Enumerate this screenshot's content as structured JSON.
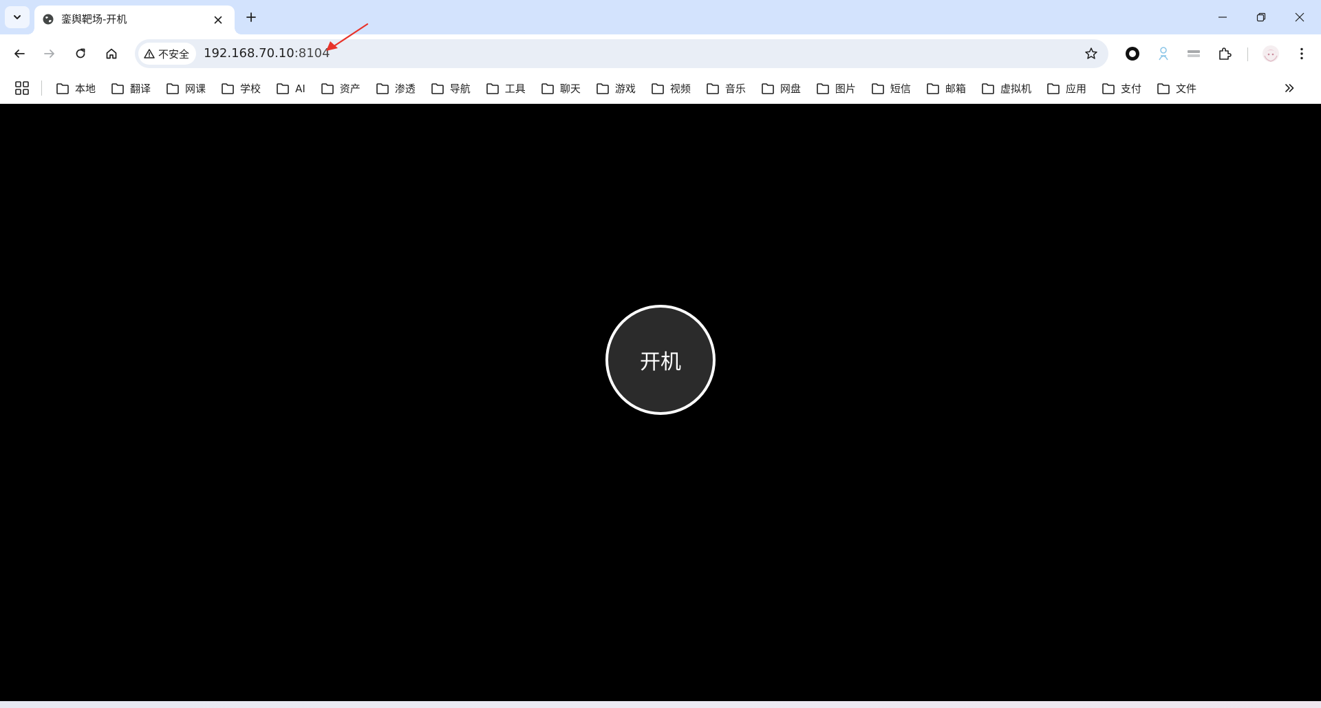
{
  "tab": {
    "title": "銮舆靶场-开机",
    "favicon": "globe-icon"
  },
  "toolbar": {
    "security_label": "不安全",
    "url_host": "192.168.70.10",
    "url_port": ":8104"
  },
  "bookmarks": [
    {
      "label": "本地"
    },
    {
      "label": "翻译"
    },
    {
      "label": "网课"
    },
    {
      "label": "学校"
    },
    {
      "label": "AI"
    },
    {
      "label": "资产"
    },
    {
      "label": "渗透"
    },
    {
      "label": "导航"
    },
    {
      "label": "工具"
    },
    {
      "label": "聊天"
    },
    {
      "label": "游戏"
    },
    {
      "label": "视频"
    },
    {
      "label": "音乐"
    },
    {
      "label": "网盘"
    },
    {
      "label": "图片"
    },
    {
      "label": "短信"
    },
    {
      "label": "邮箱"
    },
    {
      "label": "虚拟机"
    },
    {
      "label": "应用"
    },
    {
      "label": "支付"
    },
    {
      "label": "文件"
    }
  ],
  "page": {
    "power_button_label": "开机"
  },
  "colors": {
    "tabstrip_bg": "#d3e3fd",
    "omnibox_bg": "#e9eef6",
    "page_bg": "#000000",
    "annotation_arrow": "#e8332a"
  }
}
